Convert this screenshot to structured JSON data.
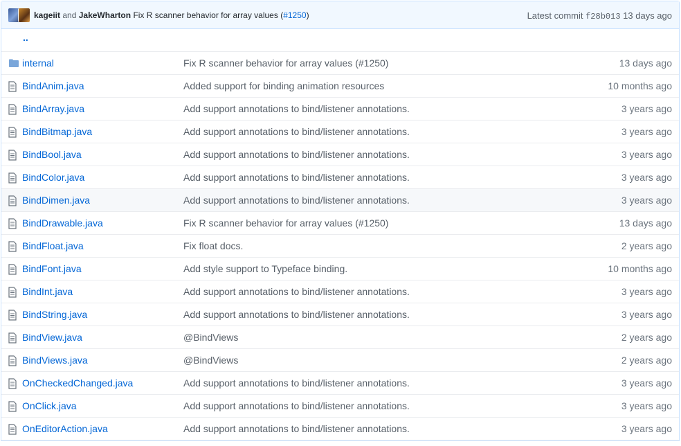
{
  "commit_bar": {
    "author1": "kageiit",
    "conjunction": "and",
    "author2": "JakeWharton",
    "message": "Fix R scanner behavior for array values (",
    "pr": "#1250",
    "message_end": ")",
    "latest_label": "Latest commit",
    "sha": "f28b013",
    "age": "13 days ago"
  },
  "parent_dir": "..",
  "files": [
    {
      "type": "folder",
      "name": "internal",
      "message": "Fix R scanner behavior for array values (#1250)",
      "age": "13 days ago"
    },
    {
      "type": "file",
      "name": "BindAnim.java",
      "message": "Added support for binding animation resources",
      "age": "10 months ago"
    },
    {
      "type": "file",
      "name": "BindArray.java",
      "message": "Add support annotations to bind/listener annotations.",
      "age": "3 years ago"
    },
    {
      "type": "file",
      "name": "BindBitmap.java",
      "message": "Add support annotations to bind/listener annotations.",
      "age": "3 years ago"
    },
    {
      "type": "file",
      "name": "BindBool.java",
      "message": "Add support annotations to bind/listener annotations.",
      "age": "3 years ago"
    },
    {
      "type": "file",
      "name": "BindColor.java",
      "message": "Add support annotations to bind/listener annotations.",
      "age": "3 years ago"
    },
    {
      "type": "file",
      "name": "BindDimen.java",
      "message": "Add support annotations to bind/listener annotations.",
      "age": "3 years ago"
    },
    {
      "type": "file",
      "name": "BindDrawable.java",
      "message": "Fix R scanner behavior for array values (#1250)",
      "age": "13 days ago"
    },
    {
      "type": "file",
      "name": "BindFloat.java",
      "message": "Fix float docs.",
      "age": "2 years ago"
    },
    {
      "type": "file",
      "name": "BindFont.java",
      "message": "Add style support to Typeface binding.",
      "age": "10 months ago"
    },
    {
      "type": "file",
      "name": "BindInt.java",
      "message": "Add support annotations to bind/listener annotations.",
      "age": "3 years ago"
    },
    {
      "type": "file",
      "name": "BindString.java",
      "message": "Add support annotations to bind/listener annotations.",
      "age": "3 years ago"
    },
    {
      "type": "file",
      "name": "BindView.java",
      "message": "@BindViews",
      "age": "2 years ago"
    },
    {
      "type": "file",
      "name": "BindViews.java",
      "message": "@BindViews",
      "age": "2 years ago"
    },
    {
      "type": "file",
      "name": "OnCheckedChanged.java",
      "message": "Add support annotations to bind/listener annotations.",
      "age": "3 years ago"
    },
    {
      "type": "file",
      "name": "OnClick.java",
      "message": "Add support annotations to bind/listener annotations.",
      "age": "3 years ago"
    },
    {
      "type": "file",
      "name": "OnEditorAction.java",
      "message": "Add support annotations to bind/listener annotations.",
      "age": "3 years ago"
    }
  ],
  "highlighted_row": "BindDimen.java",
  "colors": {
    "link": "#0366d6",
    "muted": "#586069",
    "header_bg": "#f1f8ff",
    "hover_bg": "#f6f8fa",
    "icon": "#6a737d"
  }
}
